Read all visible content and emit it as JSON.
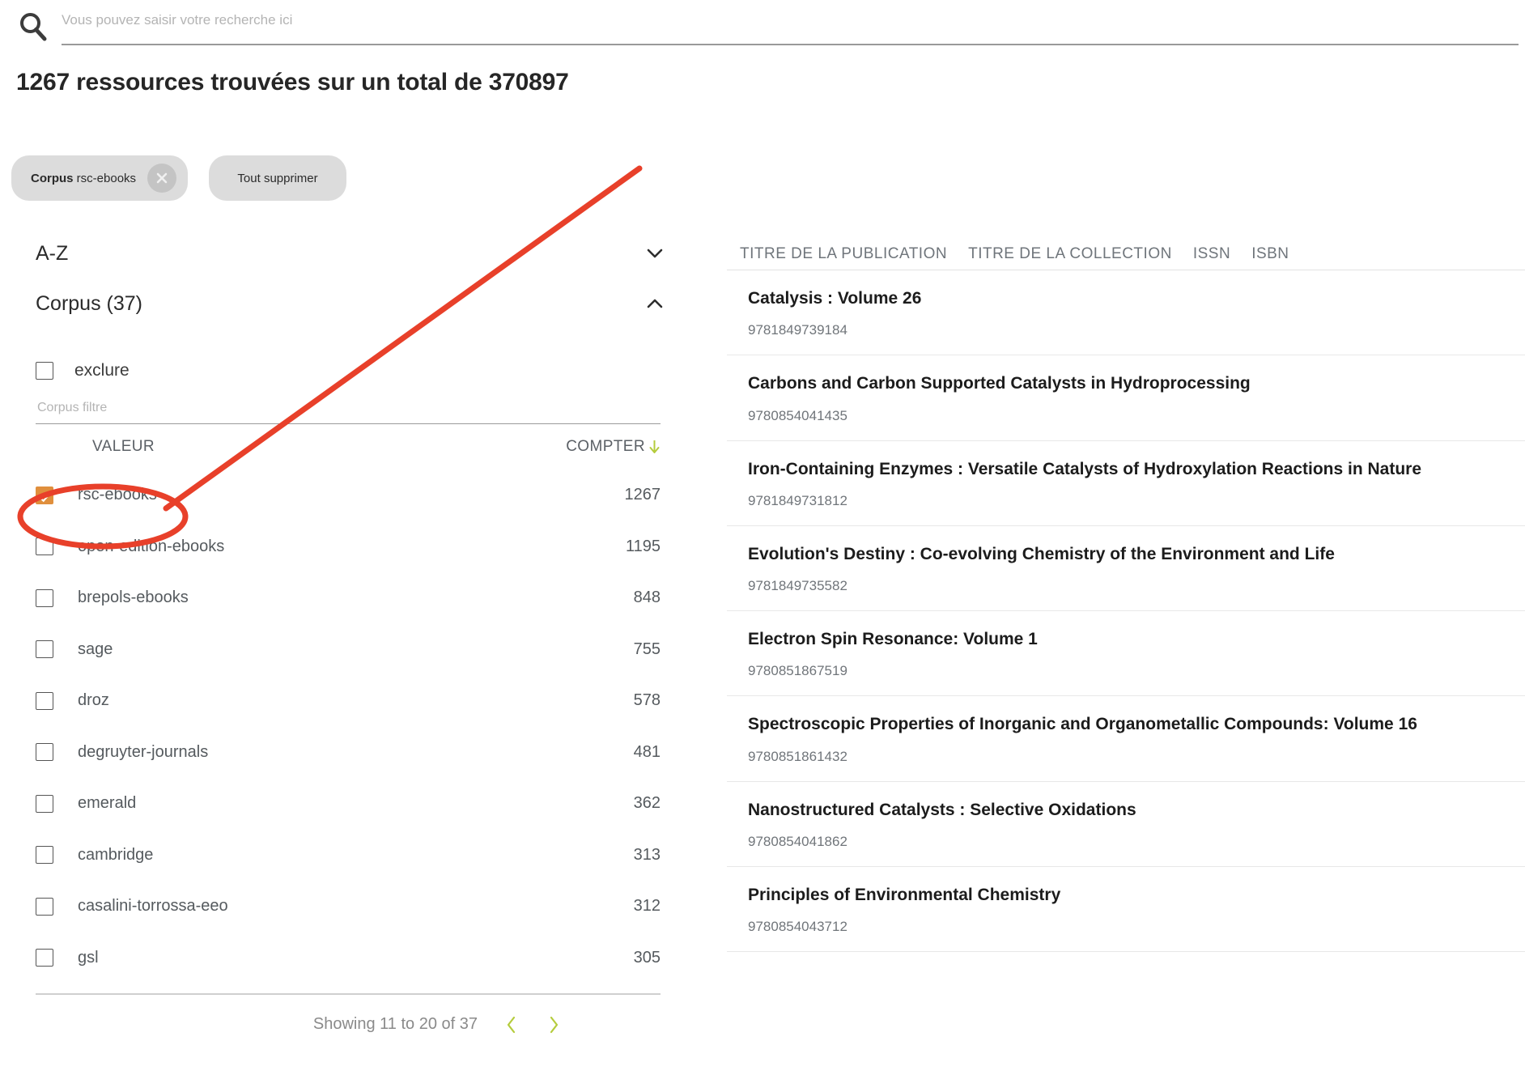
{
  "search": {
    "placeholder": "Vous pouvez saisir votre recherche ici",
    "value": "",
    "icon": "search-icon"
  },
  "heading": "1267 ressources trouvées sur un total de 370897",
  "chips": {
    "active_filter_prefix": "Corpus",
    "active_filter_value": "rsc-ebooks",
    "clear_all_label": "Tout supprimer"
  },
  "sidebar": {
    "sort": {
      "label": "A-Z",
      "chevron": "chevron-down-icon"
    },
    "facet": {
      "label": "Corpus (37)",
      "chevron": "chevron-up-icon",
      "exclude_label": "exclure",
      "exclude_checked": false,
      "filter_placeholder": "Corpus filtre",
      "filter_value": "",
      "columns": {
        "value": "VALEUR",
        "count": "COMPTER",
        "sort_direction_icon": "arrow-down-icon"
      },
      "rows": [
        {
          "label": "rsc-ebooks",
          "count": "1267",
          "checked": true
        },
        {
          "label": "open-edition-ebooks",
          "count": "1195",
          "checked": false
        },
        {
          "label": "brepols-ebooks",
          "count": "848",
          "checked": false
        },
        {
          "label": "sage",
          "count": "755",
          "checked": false
        },
        {
          "label": "droz",
          "count": "578",
          "checked": false
        },
        {
          "label": "degruyter-journals",
          "count": "481",
          "checked": false
        },
        {
          "label": "emerald",
          "count": "362",
          "checked": false
        },
        {
          "label": "cambridge",
          "count": "313",
          "checked": false
        },
        {
          "label": "casalini-torrossa-eeo",
          "count": "312",
          "checked": false
        },
        {
          "label": "gsl",
          "count": "305",
          "checked": false
        }
      ],
      "pagination": {
        "text": "Showing 11 to 20 of 37",
        "prev_icon": "chevron-left-icon",
        "next_icon": "chevron-right-icon"
      }
    }
  },
  "results": {
    "tabs": [
      {
        "label": "TITRE DE LA PUBLICATION"
      },
      {
        "label": "TITRE DE LA COLLECTION"
      },
      {
        "label": "ISSN"
      },
      {
        "label": "ISBN"
      }
    ],
    "items": [
      {
        "title": "Catalysis : Volume 26",
        "id": "9781849739184"
      },
      {
        "title": "Carbons and Carbon Supported Catalysts in Hydroprocessing",
        "id": "9780854041435"
      },
      {
        "title": "Iron-Containing Enzymes : Versatile Catalysts of Hydroxylation Reactions in Nature",
        "id": "9781849731812"
      },
      {
        "title": "Evolution's Destiny : Co-evolving Chemistry of the Environment and Life",
        "id": "9781849735582"
      },
      {
        "title": "Electron Spin Resonance: Volume 1",
        "id": "9780851867519"
      },
      {
        "title": "Spectroscopic Properties of Inorganic and Organometallic Compounds: Volume 16",
        "id": "9780851861432"
      },
      {
        "title": "Nanostructured Catalysts : Selective Oxidations",
        "id": "9780854041862"
      },
      {
        "title": "Principles of Environmental Chemistry",
        "id": "9780854043712"
      }
    ]
  },
  "colors": {
    "accent_green": "#b5cc3d",
    "checked_orange": "#e08f3c",
    "annotation_red": "#e8402a",
    "chip_grey": "#dcdcdc"
  }
}
